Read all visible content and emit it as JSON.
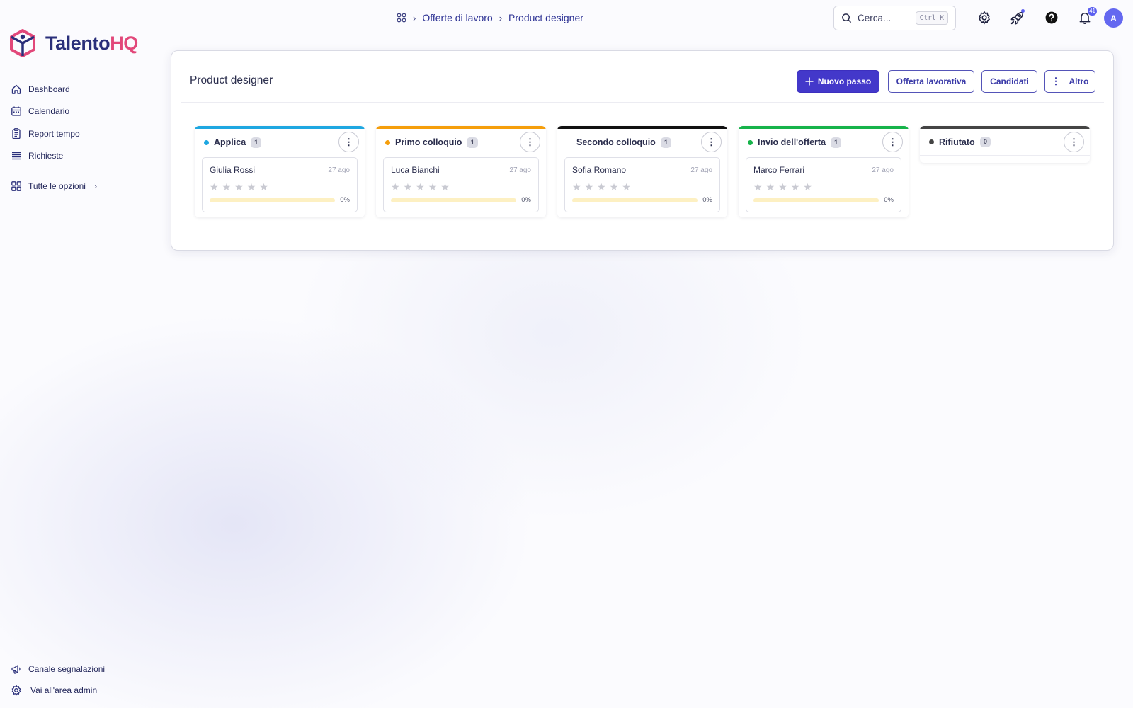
{
  "app": {
    "name_part1": "Talento",
    "name_part2": "HQ",
    "brand_color": "#e2487a",
    "primary_color": "#4338ca"
  },
  "sidebar": {
    "items": [
      {
        "label": "Dashboard",
        "icon": "home-icon"
      },
      {
        "label": "Calendario",
        "icon": "calendar-icon"
      },
      {
        "label": "Report tempo",
        "icon": "report-icon"
      },
      {
        "label": "Richieste",
        "icon": "requests-icon"
      }
    ],
    "all_options": {
      "label": "Tutte le opzioni",
      "chevron": "›",
      "icon": "grid-icon"
    },
    "bottom": [
      {
        "label": "Canale segnalazioni",
        "icon": "megaphone-icon"
      },
      {
        "label": "Vai all'area admin",
        "icon": "gear-icon"
      }
    ]
  },
  "breadcrumb": {
    "sep": "›",
    "items": [
      "Offerte di lavoro",
      "Product designer"
    ]
  },
  "search": {
    "placeholder": "Cerca...",
    "shortcut": "Ctrl K"
  },
  "header": {
    "notifications_count": "41",
    "avatar_initial": "A"
  },
  "page": {
    "title": "Product designer",
    "buttons": {
      "new_step": "Nuovo passo",
      "offer": "Offerta lavorativa",
      "candidates": "Candidati",
      "more": "Altro"
    }
  },
  "stages": [
    {
      "name": "Applica",
      "count": "1",
      "color": "#1ea7e1",
      "dot": true,
      "cards": [
        {
          "name": "Giulia Rossi",
          "date": "27 ago",
          "rating": 0,
          "progress": 0,
          "progress_label": "0%"
        }
      ]
    },
    {
      "name": "Primo colloquio",
      "count": "1",
      "color": "#f59e0b",
      "dot": true,
      "cards": [
        {
          "name": "Luca Bianchi",
          "date": "27 ago",
          "rating": 0,
          "progress": 0,
          "progress_label": "0%"
        }
      ]
    },
    {
      "name": "Secondo colloquio",
      "count": "1",
      "color": "#111111",
      "dot": false,
      "cards": [
        {
          "name": "Sofia Romano",
          "date": "27 ago",
          "rating": 0,
          "progress": 0,
          "progress_label": "0%"
        }
      ]
    },
    {
      "name": "Invio dell'offerta",
      "count": "1",
      "color": "#16b34a",
      "dot": true,
      "cards": [
        {
          "name": "Marco Ferrari",
          "date": "27 ago",
          "rating": 0,
          "progress": 0,
          "progress_label": "0%"
        }
      ]
    },
    {
      "name": "Rifiutato",
      "count": "0",
      "color": "#444444",
      "dot": true,
      "cards": []
    }
  ]
}
